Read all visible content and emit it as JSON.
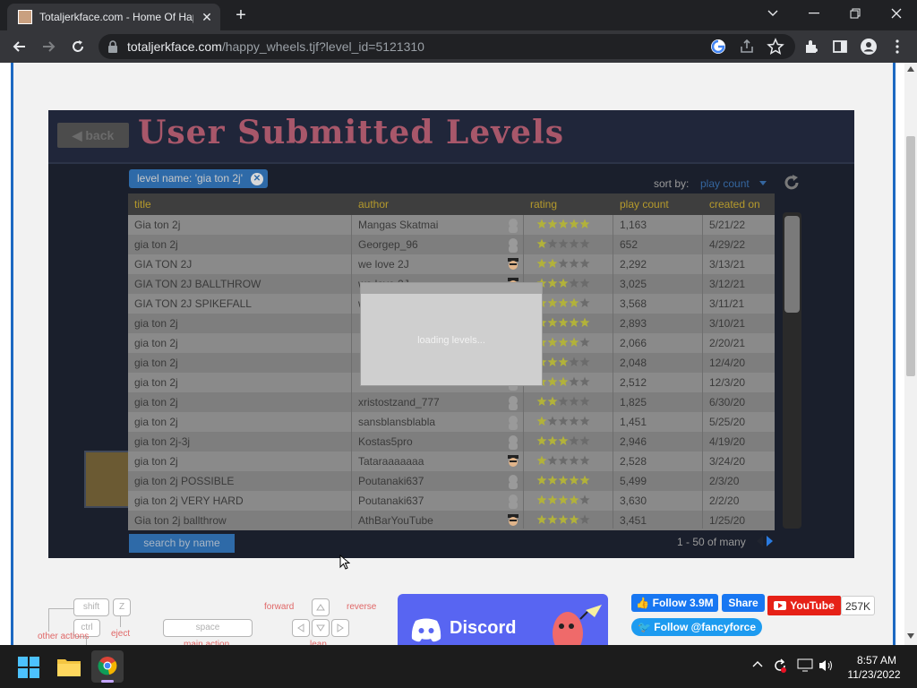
{
  "browser": {
    "tab_title": "Totaljerkface.com - Home Of Hap",
    "url_host": "totaljerkface.com",
    "url_path": "/happy_wheels.tjf?level_id=5121310",
    "tab_close": "✕",
    "new_tab": "+"
  },
  "game": {
    "back_label": "back",
    "heading": "User Submitted Levels",
    "filter_tag": "level name: 'gia ton 2j'",
    "sort_label": "sort by:",
    "sort_value": "play count",
    "columns": {
      "title": "title",
      "author": "author",
      "rating": "rating",
      "play_count": "play count",
      "created_on": "created on"
    },
    "rows": [
      {
        "title": "Gia ton 2j",
        "author": "Mangas Skatmai",
        "avatar": "none",
        "rating": 5,
        "plays": "1,163",
        "created": "5/21/22"
      },
      {
        "title": "gia ton 2j",
        "author": "Georgep_96",
        "avatar": "none",
        "rating": 1,
        "plays": "652",
        "created": "4/29/22"
      },
      {
        "title": "GIA TON 2J",
        "author": "we love 2J",
        "avatar": "face",
        "rating": 2,
        "plays": "2,292",
        "created": "3/13/21"
      },
      {
        "title": "GIA TON 2J BALLTHROW",
        "author": "we love 2J",
        "avatar": "face",
        "rating": 3,
        "plays": "3,025",
        "created": "3/12/21"
      },
      {
        "title": "GIA TON 2J SPIKEFALL",
        "author": "we love 2J",
        "avatar": "none",
        "rating": 4,
        "plays": "3,568",
        "created": "3/11/21"
      },
      {
        "title": "gia ton 2j",
        "author": "",
        "avatar": "none",
        "rating": 5,
        "plays": "2,893",
        "created": "3/10/21"
      },
      {
        "title": "gia ton 2j",
        "author": "",
        "avatar": "none",
        "rating": 4,
        "plays": "2,066",
        "created": "2/20/21"
      },
      {
        "title": "gia ton 2j",
        "author": "",
        "avatar": "none",
        "rating": 3,
        "plays": "2,048",
        "created": "12/4/20"
      },
      {
        "title": "gia ton 2j",
        "author": "",
        "avatar": "none",
        "rating": 3,
        "plays": "2,512",
        "created": "12/3/20"
      },
      {
        "title": "gia ton 2j",
        "author": "xristostzand_777",
        "avatar": "none",
        "rating": 2,
        "plays": "1,825",
        "created": "6/30/20"
      },
      {
        "title": "gia ton 2j",
        "author": "sansblansblabla",
        "avatar": "none",
        "rating": 1,
        "plays": "1,451",
        "created": "5/25/20"
      },
      {
        "title": "gia ton 2j-3j",
        "author": "Kostas5pro",
        "avatar": "none",
        "rating": 3,
        "plays": "2,946",
        "created": "4/19/20"
      },
      {
        "title": "gia ton 2j",
        "author": "Tataraaaaaaa",
        "avatar": "face",
        "rating": 1,
        "plays": "2,528",
        "created": "3/24/20"
      },
      {
        "title": "gia ton 2j POSSIBLE",
        "author": "Poutanaki637",
        "avatar": "none",
        "rating": 5,
        "plays": "5,499",
        "created": "2/3/20"
      },
      {
        "title": "gia ton 2j VERY HARD",
        "author": "Poutanaki637",
        "avatar": "none",
        "rating": 4,
        "plays": "3,630",
        "created": "2/2/20"
      },
      {
        "title": "Gia ton 2j ballthrow",
        "author": "AthBarYouTube",
        "avatar": "face",
        "rating": 4,
        "plays": "3,451",
        "created": "1/25/20"
      }
    ],
    "search_label": "search by name",
    "pager": "1 - 50 of many",
    "loading": "loading levels..."
  },
  "controls": {
    "shift": "shift",
    "z": "Z",
    "ctrl": "ctrl",
    "eject": "eject",
    "other_actions": "other actions",
    "space": "space",
    "primary_action": "main action",
    "forward": "forward",
    "reverse": "reverse",
    "lean": "lean"
  },
  "discord_label": "Discord",
  "social": {
    "fb_follow": "Follow 3.9M",
    "fb_share": "Share",
    "youtube": "YouTube",
    "youtube_count": "257K",
    "twitter": "Follow @fancyforce"
  },
  "taskbar": {
    "time": "8:57 AM",
    "date": "11/23/2022"
  },
  "colors": {
    "page_border": "#1d69c2",
    "heading": "#a8576a",
    "star_on": "#b2b23a",
    "star_off": "#6b6b6b"
  }
}
